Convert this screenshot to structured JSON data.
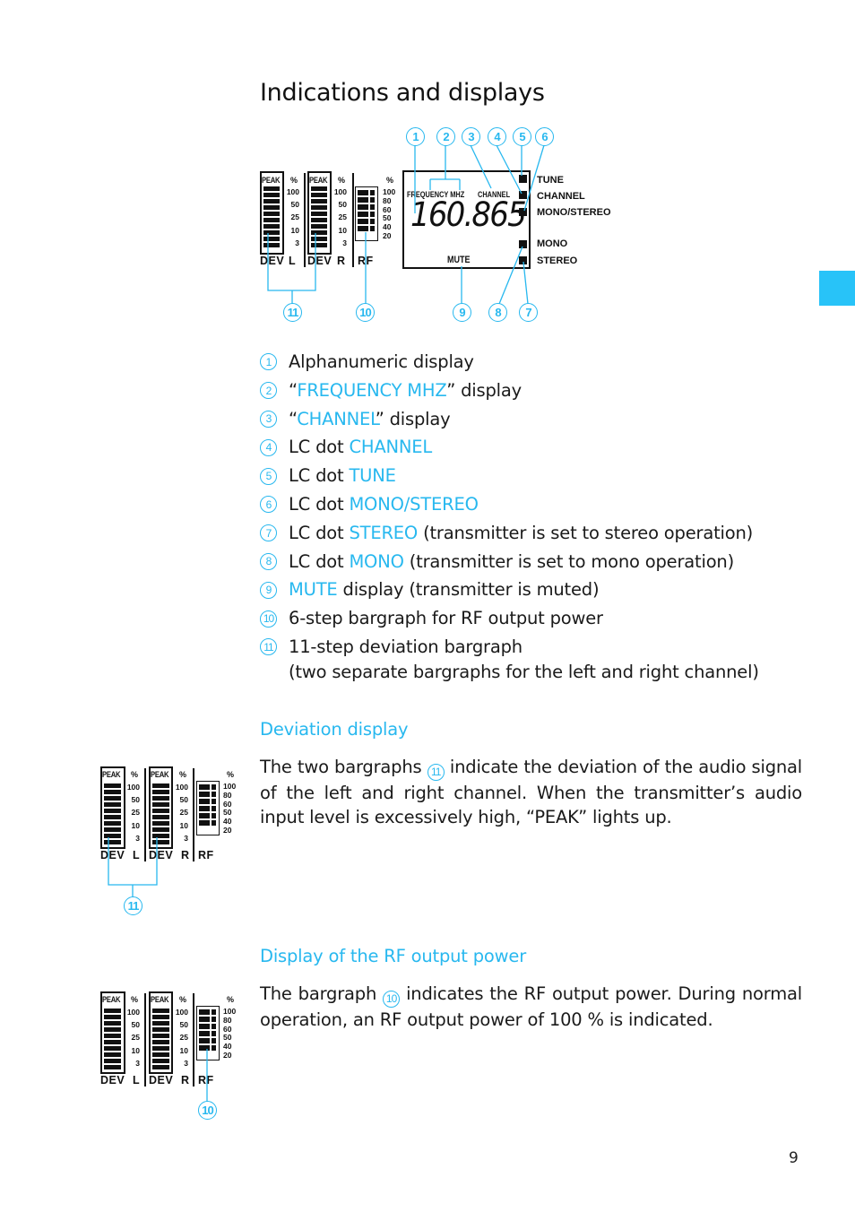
{
  "page": {
    "title": "Indications and displays",
    "page_number": "9",
    "accent_color": "#28b8ef",
    "tab_marker_color": "#28c3f8"
  },
  "main_diagram": {
    "dev_l": {
      "peak": "PEAK",
      "label_dev": "DEV",
      "label_ch": "L",
      "pct": "%",
      "scale": [
        "100",
        "50",
        "25",
        "10",
        "3"
      ],
      "steps": 11
    },
    "dev_r": {
      "peak": "PEAK",
      "label_dev": "DEV",
      "label_ch": "R",
      "pct": "%",
      "scale": [
        "100",
        "50",
        "25",
        "10",
        "3"
      ],
      "steps": 11
    },
    "rf": {
      "label": "RF",
      "pct": "%",
      "scale": [
        "100",
        "80",
        "60",
        "50",
        "40",
        "20"
      ],
      "steps": 6
    },
    "lcd": {
      "frequency_label": "FREQUENCY MHZ",
      "channel_label": "CHANNEL",
      "frequency_value": "160.865",
      "mute_label": "MUTE"
    },
    "side_labels": {
      "tune": "TUNE",
      "channel": "CHANNEL",
      "mono_stereo": "MONO/STEREO",
      "mono": "MONO",
      "stereo": "STEREO"
    },
    "callouts": [
      "1",
      "2",
      "3",
      "4",
      "5",
      "6",
      "7",
      "8",
      "9",
      "10",
      "11"
    ]
  },
  "legend": [
    {
      "num": "1",
      "pre": "Alphanumeric display",
      "hl": "",
      "post": ""
    },
    {
      "num": "2",
      "pre": "“",
      "hl": "FREQUENCY MHZ",
      "post": "” display"
    },
    {
      "num": "3",
      "pre": "“",
      "hl": "CHANNEL",
      "post": "” display"
    },
    {
      "num": "4",
      "pre": "LC dot ",
      "hl": "CHANNEL",
      "post": ""
    },
    {
      "num": "5",
      "pre": "LC dot ",
      "hl": "TUNE",
      "post": ""
    },
    {
      "num": "6",
      "pre": "LC dot ",
      "hl": "MONO/STEREO",
      "post": ""
    },
    {
      "num": "7",
      "pre": "LC dot ",
      "hl": "STEREO",
      "post": " (transmitter is set to stereo operation)"
    },
    {
      "num": "8",
      "pre": "LC dot ",
      "hl": "MONO",
      "post": " (transmitter is set to mono operation)"
    },
    {
      "num": "9",
      "pre": "",
      "hl": "MUTE",
      "post": " display (transmitter is muted)"
    },
    {
      "num": "10",
      "pre": "6-step bargraph for RF output power",
      "hl": "",
      "post": ""
    },
    {
      "num": "11",
      "pre": "11-step deviation bargraph",
      "hl": "",
      "post": "",
      "line2": "(two separate bargraphs for the left and right channel)"
    }
  ],
  "deviation_section": {
    "heading": "Deviation display",
    "text_before": "The two bargraphs ",
    "callout": "11",
    "text_after": " indicate the deviation of the audio signal of the left and right channel. When the transmitter’s audio input level is excessively high, “PEAK” lights up."
  },
  "rf_section": {
    "heading": "Display of the RF output power",
    "text_before": "The bargraph ",
    "callout": "10",
    "text_after": " indicates the RF output power. During normal operation, an RF output power of 100 % is indicated."
  }
}
